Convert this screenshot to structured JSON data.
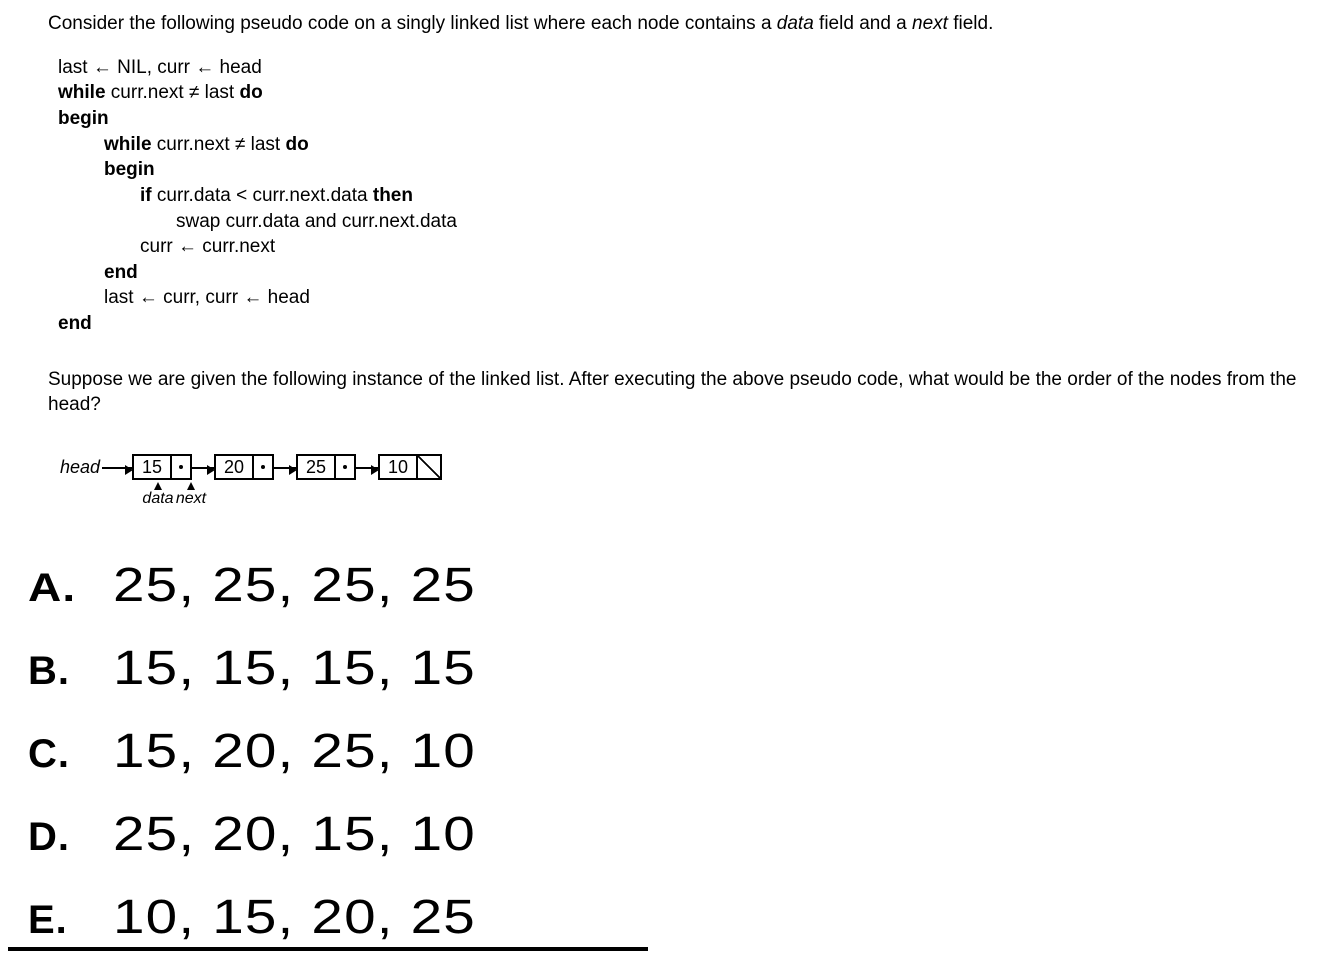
{
  "intro": {
    "prefix": "Consider the following pseudo code on a singly linked list where each node contains a ",
    "data_word": "data",
    "mid": " field and a ",
    "next_word": "next",
    "suffix": " field."
  },
  "pseudo": {
    "l1_a": "last ← NIL, curr ← head",
    "l2_kw1": "while",
    "l2_mid": " curr.next ≠ last ",
    "l2_kw2": "do",
    "l3_kw": "begin",
    "l4_kw1": "while",
    "l4_mid": " curr.next ≠ last ",
    "l4_kw2": "do",
    "l5_kw": "begin",
    "l6_kw1": "if",
    "l6_mid": " curr.data < curr.next.data ",
    "l6_kw2": "then",
    "l7": "swap curr.data and curr.next.data",
    "l8": "curr ← curr.next",
    "l9_kw": "end",
    "l10": "last ← curr, curr ← head",
    "l11_kw": "end"
  },
  "question": "Suppose we are given the following instance of the linked list. After executing the above pseudo code, what would be the order of the nodes from the head?",
  "linked_list": {
    "head_label": "head",
    "nodes": [
      "15",
      "20",
      "25",
      "10"
    ],
    "data_label": "data",
    "next_label": "next"
  },
  "answers": [
    {
      "label": "A.",
      "text": "25, 25, 25, 25"
    },
    {
      "label": "B.",
      "text": "15, 15, 15, 15"
    },
    {
      "label": "C.",
      "text": "15, 20, 25, 10"
    },
    {
      "label": "D.",
      "text": "25, 20, 15, 10"
    },
    {
      "label": "E.",
      "text": "10, 15, 20, 25"
    }
  ]
}
